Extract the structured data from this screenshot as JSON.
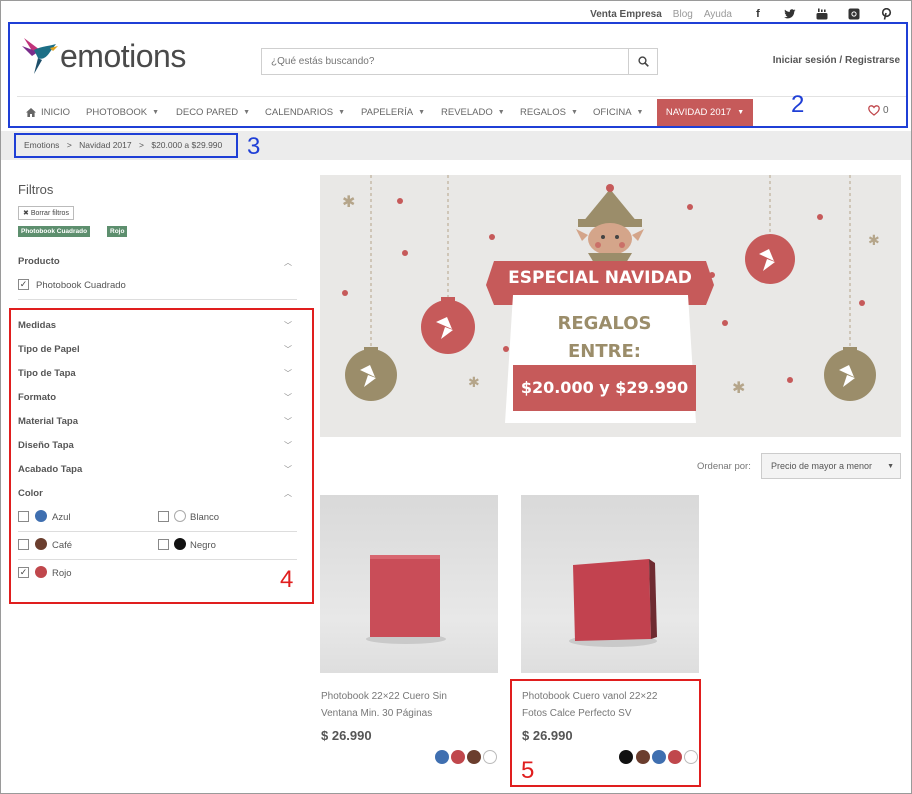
{
  "topbar": {
    "links": [
      "Venta Empresa",
      "Blog",
      "Ayuda"
    ],
    "social_icons": [
      "facebook-icon",
      "twitter-icon",
      "youtube-icon",
      "instagram-icon",
      "pinterest-icon"
    ]
  },
  "header": {
    "logo_text": "emotions",
    "search_placeholder": "¿Qué estás buscando?",
    "login": "Iniciar sesión / Registrarse"
  },
  "nav": {
    "home": "INICIO",
    "items": [
      "PHOTOBOOK",
      "DECO PARED",
      "CALENDARIOS",
      "PAPELERÍA",
      "REVELADO",
      "REGALOS",
      "OFICINA"
    ],
    "active": "NAVIDAD 2017",
    "cart_count": "0"
  },
  "breadcrumb": [
    "Emotions",
    ">",
    "Navidad 2017",
    ">",
    "$20.000 a $29.990"
  ],
  "filters": {
    "title": "Filtros",
    "clear": "Borrar filtros",
    "active_tags": [
      "Photobook Cuadrado",
      "Rojo"
    ],
    "producto_title": "Producto",
    "producto_option": "Photobook Cuadrado",
    "sections": [
      "Medidas",
      "Tipo de Papel",
      "Tipo de Tapa",
      "Formato",
      "Material Tapa",
      "Diseño Tapa",
      "Acabado Tapa"
    ],
    "color_title": "Color",
    "colors": [
      {
        "label": "Azul",
        "hex": "#3f6fb0",
        "checked": false
      },
      {
        "label": "Blanco",
        "hex": "#ffffff",
        "checked": false
      },
      {
        "label": "Café",
        "hex": "#6b3e2e",
        "checked": false
      },
      {
        "label": "Negro",
        "hex": "#111111",
        "checked": false
      },
      {
        "label": "Rojo",
        "hex": "#c0474c",
        "checked": true
      }
    ]
  },
  "banner": {
    "headline": "ESPECIAL NAVIDAD",
    "line1": "REGALOS",
    "line2": "ENTRE:",
    "price_range": "$20.000 y $29.990"
  },
  "sort": {
    "label": "Ordenar por:",
    "value": "Precio de mayor a menor"
  },
  "products": [
    {
      "name_line1": "Photobook 22×22 Cuero Sin",
      "name_line2": "Ventana Min. 30 Páginas",
      "price": "$ 26.990",
      "swatches": [
        "#3f6fb0",
        "#c0474c",
        "#6b3e2e",
        "#ffffff"
      ]
    },
    {
      "name_line1": "Photobook Cuero vanol 22×22",
      "name_line2": "Fotos Calce Perfecto SV",
      "price": "$ 26.990",
      "swatches": [
        "#111111",
        "#6b3e2e",
        "#3f6fb0",
        "#c0474c",
        "#ffffff"
      ]
    }
  ],
  "annotations": [
    "2",
    "3",
    "4",
    "5"
  ],
  "colors": {
    "accent": "#c65a5a",
    "tag": "#5d8f6e",
    "band": "#ececec"
  }
}
